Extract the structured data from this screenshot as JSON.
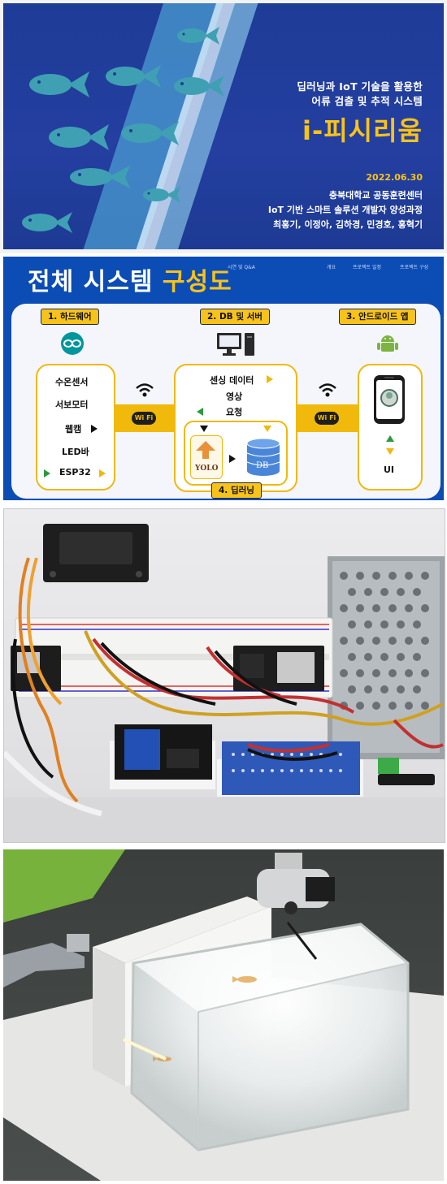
{
  "slide1": {
    "subtitle_line1": "딥러닝과 IoT 기술을 활용한",
    "subtitle_line2": "어류 검출 및 추적 시스템",
    "title": "i-피시리움",
    "date": "2022.06.30",
    "org": "충북대학교 공동훈련센터",
    "course": "IoT 기반 스마트 솔루션 개발자 양성과정",
    "authors": "최홍기, 이정아, 김하경, 민경호, 홍혁기",
    "colors": {
      "background": "#1e3c97",
      "accent": "#f7c31b",
      "fish": "#3fa0b3"
    }
  },
  "slide2": {
    "title_main": "전체 시스템 ",
    "title_highlight": "구성도",
    "nav": [
      "시연 및 Q&A",
      "개요",
      "프로젝트 일정",
      "프로젝트 구성"
    ],
    "sections": {
      "hardware": "1. 하드웨어",
      "db_server": "2. DB 및 서버",
      "android": "3. 안드로이드 앱",
      "deep_learning": "4. 딥러닝"
    },
    "hardware_items": [
      "수온센서",
      "서보모터",
      "웹캠",
      "LED바",
      "ESP32"
    ],
    "server_items": [
      "센싱 데이터",
      "영상",
      "요청"
    ],
    "wifi_label": "Wi Fi",
    "db_label": "DB",
    "yolo_label": "YOLO",
    "app_label": "UI",
    "icons": [
      "arduino-icon",
      "computer-icon",
      "android-icon",
      "wifi-icon",
      "database-icon",
      "smartphone-icon"
    ],
    "colors": {
      "background": "#0c4db5",
      "accent": "#f0b90c",
      "green": "#2c9a3c"
    }
  },
  "photo1": {
    "subject": "hardware-board"
  },
  "photo2": {
    "subject": "fish-tank"
  }
}
